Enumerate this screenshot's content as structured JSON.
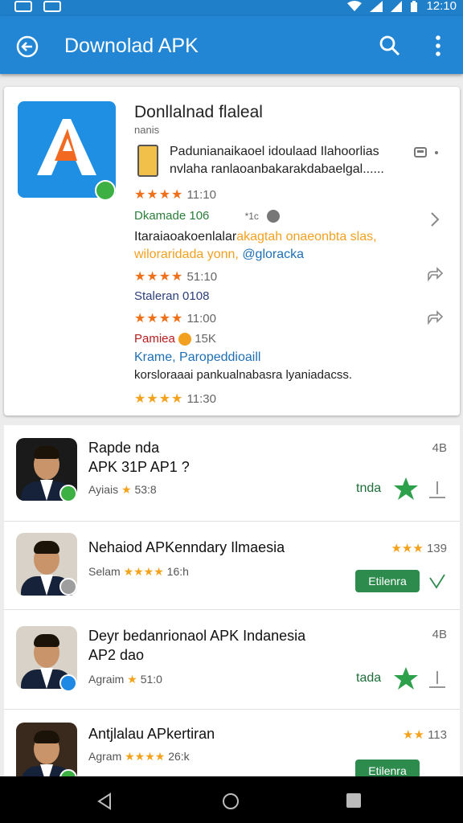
{
  "status_bar": {
    "time": "12:10"
  },
  "app_bar": {
    "title": "Downolad APK"
  },
  "featured": {
    "title": "Donllalnad flaleal",
    "subtitle": "nanis",
    "description": "Padunianaikaoel idoulaad Ilahoorlias nvlaha ranlaoanbakarakdabaelgal......",
    "rating1": {
      "stars": "★★★★",
      "value": "11:10"
    },
    "line_a": {
      "label": "Dkamade 106",
      "extra": "*1c"
    },
    "line_b_part1": "Itaraiaoakoenlalar",
    "line_b_part2": "akagtah onaeonbta slas,",
    "line_c_part1": "wiloraridada yonn,",
    "line_c_part2": "@gloracka",
    "rating2": {
      "stars": "★★★★",
      "value": "51:10"
    },
    "line_d": "Staleran 0108",
    "rating3": {
      "stars": "★★★★",
      "value": "11:00"
    },
    "line_e": {
      "label": "Pamiea",
      "count": "15K"
    },
    "line_f": "Krame, Paropeddioaill",
    "line_g": "korsloraaai pankualnabasra lyaniadacss.",
    "rating4": {
      "stars": "★★★★",
      "value": "11:30"
    }
  },
  "list": [
    {
      "name": "Rapde nda",
      "name2": "APK 31P AP1 ?",
      "meta_label": "Ayiais",
      "stars": "★",
      "meta_value": "53:8",
      "right": "4B",
      "action": "tnda",
      "badge_color": "#3cb043"
    },
    {
      "name": "Nehaiod APKenndary Ilmaesia",
      "meta_label": "Selam",
      "stars": "★★★★",
      "meta_value": "16:h",
      "right_stars": "★★★",
      "right": "139",
      "button": "Etilenra",
      "badge_color": "#9e9e9e"
    },
    {
      "name": "Deyr bedanrionaol APK Indanesia",
      "name2": "AP2 dao",
      "meta_label": "Agraim",
      "stars": "★",
      "meta_value": "51:0",
      "right": "4B",
      "action": "tada",
      "badge_color": "#1e88e5"
    },
    {
      "name": "Antjlalau APkertiran",
      "meta_label": "Agram",
      "stars": "★★★★",
      "meta_value": "26:k",
      "right_stars": "★★",
      "right": "113",
      "button": "Etilenra",
      "badge_color": "#3cb043"
    }
  ],
  "colors": {
    "primary": "#2286d4",
    "accent_green": "#2e8b4e",
    "star": "#f4a21b"
  }
}
